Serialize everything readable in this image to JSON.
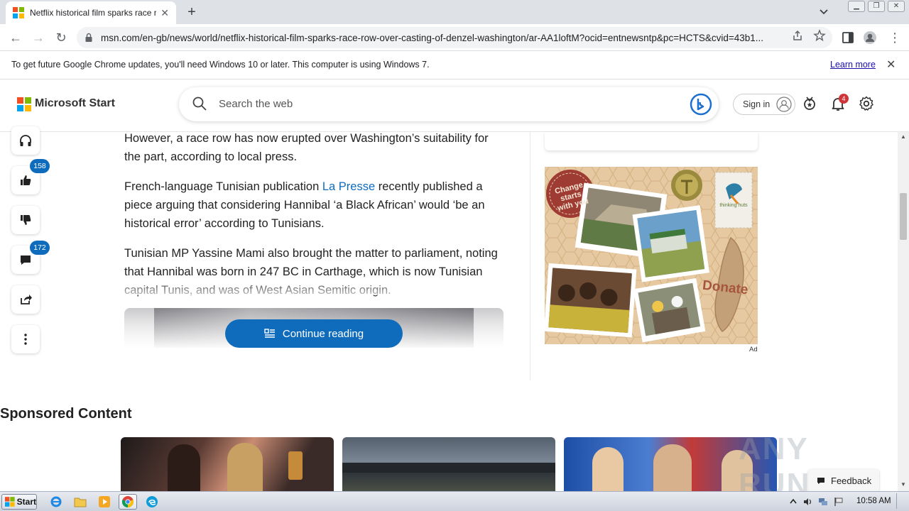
{
  "browser": {
    "tab_title": "Netflix historical film sparks race row over casting of denzel washington",
    "tab_close_icon": "close-icon",
    "new_tab_label": "+",
    "url": "msn.com/en-gb/news/world/netflix-historical-film-sparks-race-row-over-casting-of-denzel-washington/ar-AA1loftM?ocid=entnewsntp&pc=HCTS&cvid=43b1...",
    "infobar_text": "To get future Google Chrome updates, you'll need Windows 10 or later. This computer is using Windows 7.",
    "infobar_link": "Learn more"
  },
  "header": {
    "brand": "Microsoft Start",
    "search_placeholder": "Search the web",
    "signin_label": "Sign in",
    "notification_count": "4"
  },
  "rail": {
    "like_count": "158",
    "comment_count": "172"
  },
  "article": {
    "p1": "However, a race row has now erupted over Washington’s suitability for the part, according to local press.",
    "p2_before": "French-language Tunisian publication ",
    "p2_link": "La Presse",
    "p2_after": " recently published a piece arguing that considering Hannibal ‘a Black African’ would ‘be an historical error’ according to Tunisians.",
    "p3": "Tunisian MP Yassine Mami also brought the matter to parliament, noting that Hannibal was born in 247 BC in Carthage, which is now Tunisian capital Tunis, and was of West Asian Semitic origin.",
    "continue_label": "Continue reading"
  },
  "ad": {
    "stamp_text": "Change starts with you",
    "brand_text": "thinking huts",
    "donate_text": "Donate",
    "ad_label": "Ad"
  },
  "sponsored": {
    "title": "Sponsored Content"
  },
  "feedback_label": "Feedback",
  "watermark_text": "ANY RUN",
  "taskbar": {
    "start_label": "Start",
    "clock": "10:58 AM"
  },
  "colors": {
    "accent": "#0f6cbd",
    "badge_red": "#d13438",
    "ms_red": "#f25022",
    "ms_green": "#7fba00",
    "ms_blue": "#00a4ef",
    "ms_yellow": "#ffb900"
  }
}
